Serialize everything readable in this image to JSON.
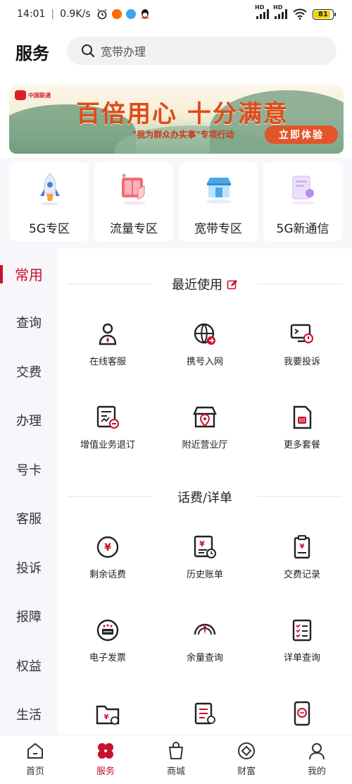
{
  "status_bar": {
    "time": "14:01",
    "speed": "0.9K/s",
    "signal_label_1": "HD",
    "signal_label_2": "HD",
    "battery": "81"
  },
  "header": {
    "title": "服务",
    "search_placeholder": "宽带办理"
  },
  "banner": {
    "brand": "中国联通",
    "headline": "百倍用心 十分满意",
    "subtitle": "\"我为群众办实事\"专项行动",
    "cta": "立即体验"
  },
  "zones": [
    {
      "label": "5G专区",
      "icon": "rocket-icon"
    },
    {
      "label": "流量专区",
      "icon": "data-card-icon"
    },
    {
      "label": "宽带专区",
      "icon": "broadband-store-icon"
    },
    {
      "label": "5G新通信",
      "icon": "new-message-icon"
    }
  ],
  "left_nav": [
    {
      "label": "常用",
      "active": true
    },
    {
      "label": "查询"
    },
    {
      "label": "交费"
    },
    {
      "label": "办理"
    },
    {
      "label": "号卡"
    },
    {
      "label": "客服"
    },
    {
      "label": "投诉"
    },
    {
      "label": "报障"
    },
    {
      "label": "权益"
    },
    {
      "label": "生活"
    }
  ],
  "sections": [
    {
      "title": "最近使用",
      "items": [
        {
          "label": "在线客服",
          "icon": "customer-service-icon"
        },
        {
          "label": "携号入网",
          "icon": "number-transfer-icon"
        },
        {
          "label": "我要投诉",
          "icon": "complaint-icon"
        },
        {
          "label": "增值业务退订",
          "icon": "unsubscribe-icon"
        },
        {
          "label": "附近营业厅",
          "icon": "nearby-store-icon"
        },
        {
          "label": "更多套餐",
          "icon": "sim-card-icon"
        }
      ]
    },
    {
      "title": "话费/详单",
      "items": [
        {
          "label": "剩余话费",
          "icon": "balance-icon"
        },
        {
          "label": "历史账单",
          "icon": "bill-history-icon"
        },
        {
          "label": "交费记录",
          "icon": "payment-record-icon"
        },
        {
          "label": "电子发票",
          "icon": "e-invoice-icon"
        },
        {
          "label": "余量查询",
          "icon": "usage-gauge-icon"
        },
        {
          "label": "详单查询",
          "icon": "detail-list-icon"
        }
      ]
    }
  ],
  "bottom_nav": [
    {
      "label": "首页",
      "icon": "home-icon"
    },
    {
      "label": "服务",
      "icon": "service-icon",
      "active": true
    },
    {
      "label": "商城",
      "icon": "shopping-bag-icon"
    },
    {
      "label": "财富",
      "icon": "wealth-icon"
    },
    {
      "label": "我的",
      "icon": "profile-icon"
    }
  ],
  "colors": {
    "accent": "#c8102e",
    "banner_cta": "#e2552b",
    "nav_bg": "#f8f5fb"
  }
}
